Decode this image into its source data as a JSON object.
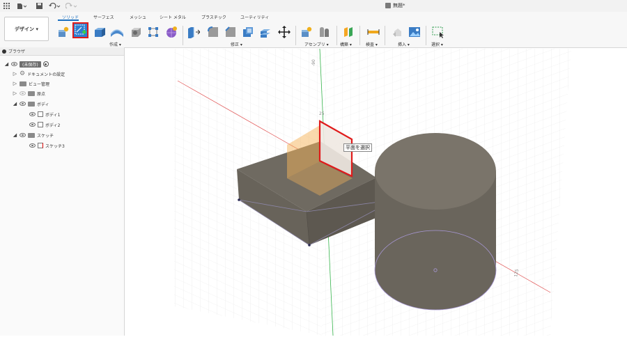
{
  "titlebar": {
    "doc_title": "無題*"
  },
  "ribbon": {
    "tabs": [
      "ソリッド",
      "サーフェス",
      "メッシュ",
      "シート メタル",
      "プラスチック",
      "ユーティリティ"
    ],
    "design_label": "デザイン ▾",
    "groups": {
      "create": "作成 ▾",
      "modify": "修正 ▾",
      "assemble": "アセンブリ ▾",
      "construct": "構築 ▾",
      "inspect": "検査 ▾",
      "insert": "挿入 ▾",
      "select": "選択 ▾"
    }
  },
  "browser": {
    "title": "ブラウザ",
    "root": "(未保存)",
    "items": {
      "doc_settings": "ドキュメントの設定",
      "named_views": "ビュー管理",
      "origin": "原点",
      "bodies": "ボディ",
      "body1": "ボディ1",
      "body2": "ボディ2",
      "sketches": "スケッチ",
      "sketch3": "スケッチ3"
    }
  },
  "canvas": {
    "tooltip": "平面を選択",
    "axis_labels": [
      "-90",
      "25",
      "125"
    ]
  },
  "colors": {
    "accent": "#1a6fbf",
    "highlight": "#e01b1b",
    "plane": "#f5b45a",
    "body": "#6f6a61"
  }
}
